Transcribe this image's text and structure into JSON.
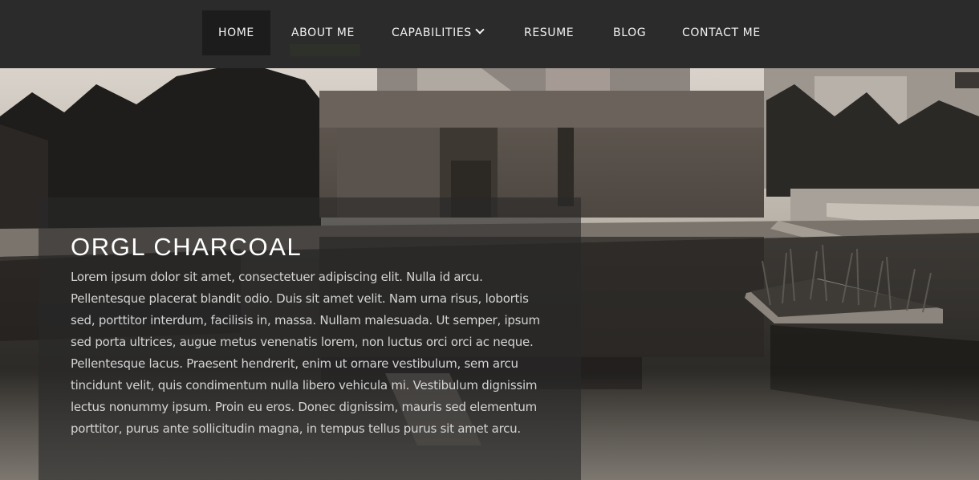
{
  "nav": {
    "items": [
      {
        "label": "HOME",
        "active": true
      },
      {
        "label": "ABOUT ME",
        "active": false
      },
      {
        "label": "CAPABILITIES",
        "active": false,
        "has_dropdown": true
      },
      {
        "label": "RESUME",
        "active": false
      },
      {
        "label": "BLOG",
        "active": false
      },
      {
        "label": "CONTACT ME",
        "active": false
      }
    ]
  },
  "hero": {
    "title": "ORGL CHARCOAL",
    "body": "Lorem ipsum dolor sit amet, consectetuer adipiscing elit. Nulla id arcu. Pellentesque placerat blandit odio. Duis sit amet velit. Nam urna risus, lobortis sed, porttitor interdum, facilisis in, massa. Nullam malesuada. Ut semper, ipsum sed porta ultrices, augue metus venenatis lorem, non luctus orci orci ac neque. Pellentesque lacus. Praesent hendrerit, enim ut ornare vestibulum, sem arcu tincidunt velit, quis condimentum nulla libero vehicula mi. Vestibulum dignissim lectus nonummy ipsum. Proin eu eros. Donec dignissim, mauris sed elementum porttitor, purus ante sollicitudin magna, in tempus tellus purus sit amet arcu."
  },
  "colors": {
    "nav_bg": "#2b2b2c",
    "nav_active_bg": "#1c1c1d",
    "nav_text": "#f2f2f2",
    "panel_text": "#d4d4d4",
    "title_text": "#ffffff"
  },
  "icons": {
    "dropdown": "chevron-down-icon"
  }
}
